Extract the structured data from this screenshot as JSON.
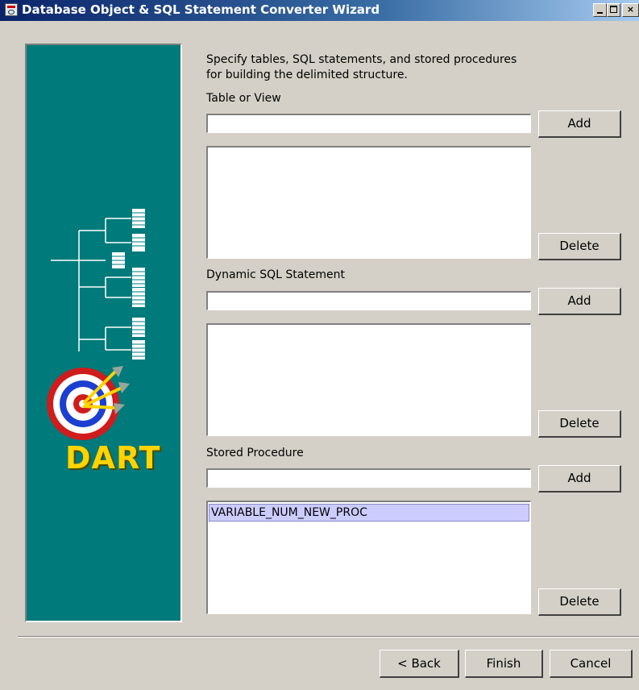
{
  "window": {
    "title": "Database Object & SQL Statement Converter Wizard"
  },
  "side_panel": {
    "logo_text": "DART",
    "colors": {
      "panel": "#007a7a",
      "logo": "#ffd400"
    }
  },
  "description": {
    "line1": "Specify tables, SQL statements, and stored procedures",
    "line2": "for building the delimited structure."
  },
  "table_section": {
    "label": "Table or View",
    "input_value": "",
    "add_label": "Add",
    "delete_label": "Delete",
    "items": []
  },
  "sql_section": {
    "label": "Dynamic SQL Statement",
    "input_value": "",
    "add_label": "Add",
    "delete_label": "Delete",
    "items": []
  },
  "proc_section": {
    "label": "Stored Procedure",
    "input_value": "",
    "add_label": "Add",
    "delete_label": "Delete",
    "items": [
      "VARIABLE_NUM_NEW_PROC"
    ]
  },
  "footer": {
    "back_label": "< Back",
    "finish_label": "Finish",
    "cancel_label": "Cancel"
  }
}
